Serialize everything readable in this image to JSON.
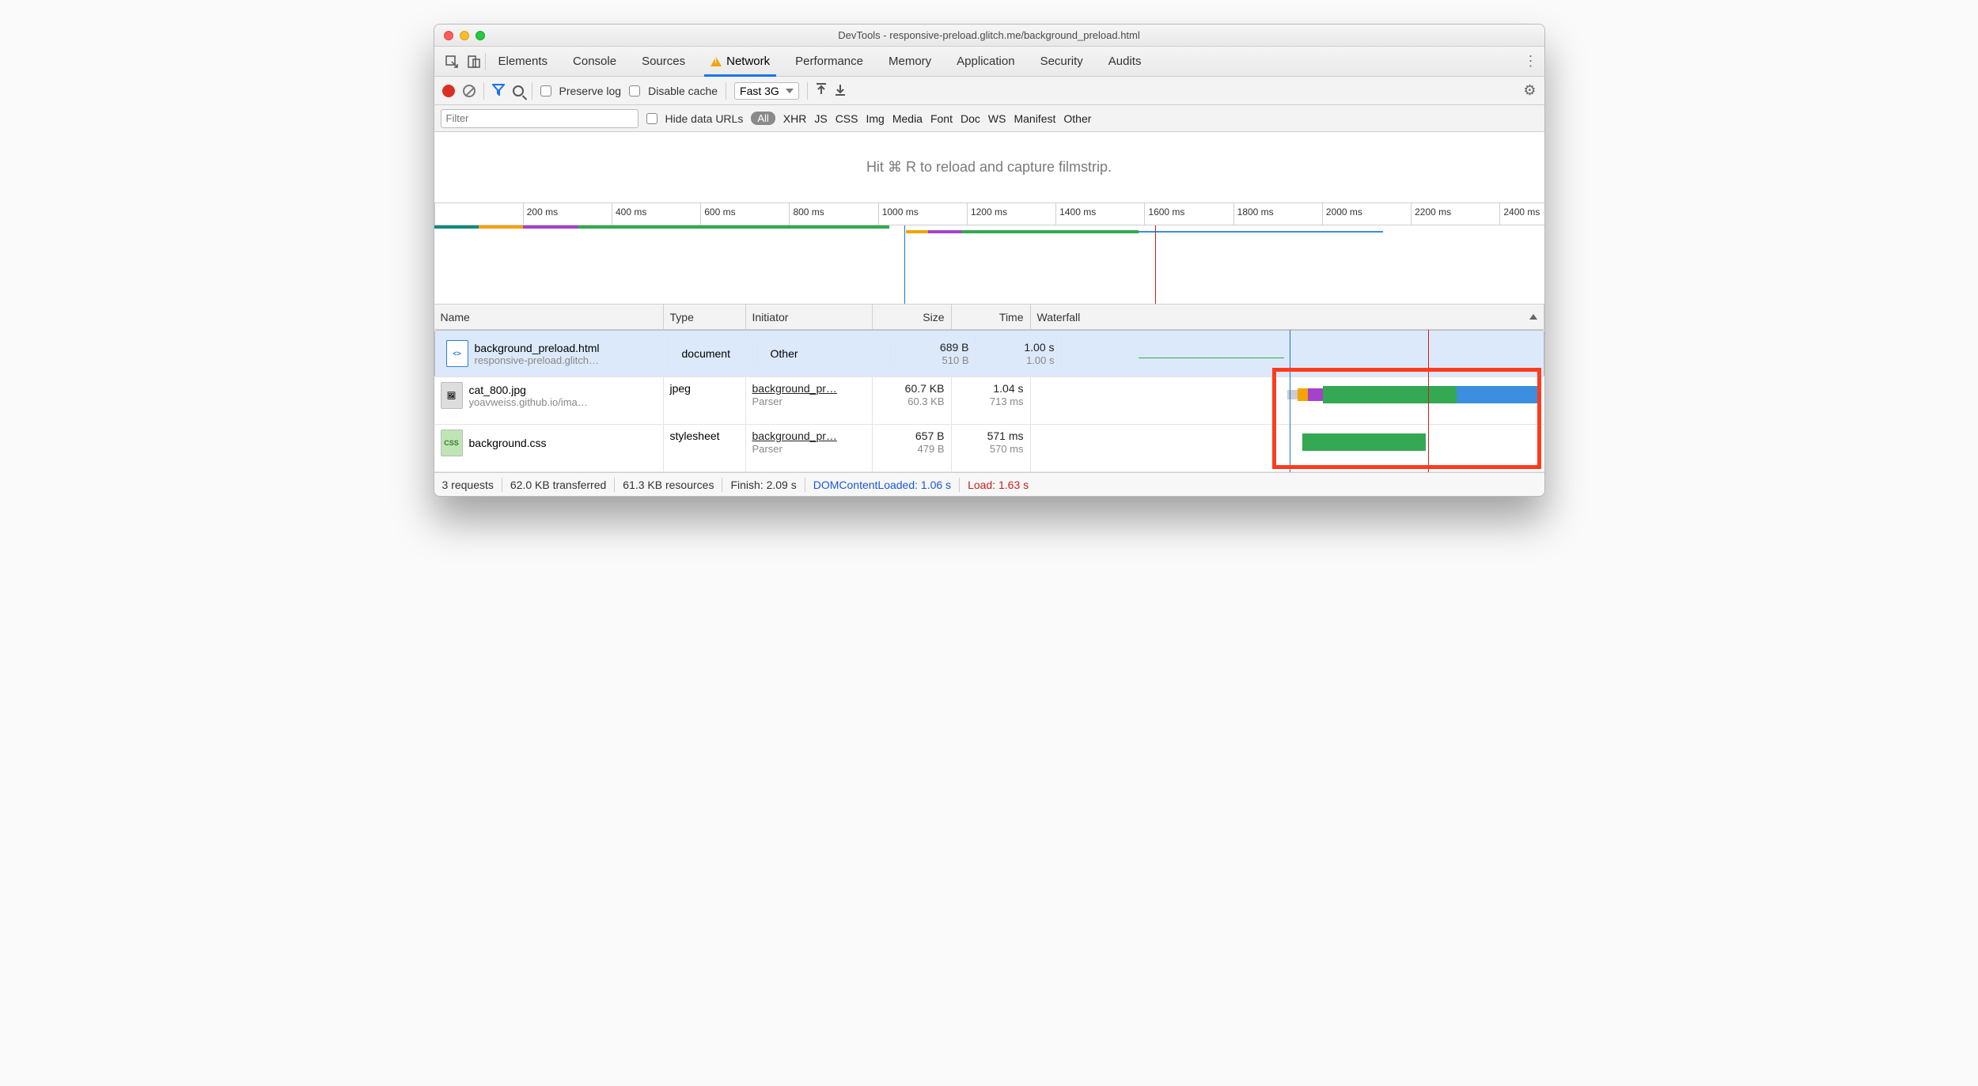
{
  "window": {
    "title": "DevTools - responsive-preload.glitch.me/background_preload.html"
  },
  "tabs": {
    "items": [
      "Elements",
      "Console",
      "Sources",
      "Network",
      "Performance",
      "Memory",
      "Application",
      "Security",
      "Audits"
    ],
    "active": "Network"
  },
  "toolbar": {
    "preserve_log": "Preserve log",
    "disable_cache": "Disable cache",
    "throttle": "Fast 3G"
  },
  "filterbar": {
    "placeholder": "Filter",
    "hide_data_urls": "Hide data URLs",
    "all_label": "All",
    "types": [
      "XHR",
      "JS",
      "CSS",
      "Img",
      "Media",
      "Font",
      "Doc",
      "WS",
      "Manifest",
      "Other"
    ]
  },
  "filmstrip": {
    "hint": "Hit ⌘ R to reload and capture filmstrip."
  },
  "ruler": {
    "labels": [
      "200 ms",
      "400 ms",
      "600 ms",
      "800 ms",
      "1000 ms",
      "1200 ms",
      "1400 ms",
      "1600 ms",
      "1800 ms",
      "2000 ms",
      "2200 ms",
      "2400 ms"
    ],
    "max_ms": 2500
  },
  "columns": {
    "name": "Name",
    "type": "Type",
    "initiator": "Initiator",
    "size": "Size",
    "time": "Time",
    "waterfall": "Waterfall"
  },
  "requests": [
    {
      "name": "background_preload.html",
      "sub": "responsive-preload.glitch…",
      "icon": "html",
      "type": "document",
      "initiator": "Other",
      "initiator_sub": "",
      "size": "689 B",
      "size_sub": "510 B",
      "time": "1.00 s",
      "time_sub": "1.00 s"
    },
    {
      "name": "cat_800.jpg",
      "sub": "yoavweiss.github.io/ima…",
      "icon": "img",
      "type": "jpeg",
      "initiator": "background_pr…",
      "initiator_sub": "Parser",
      "size": "60.7 KB",
      "size_sub": "60.3 KB",
      "time": "1.04 s",
      "time_sub": "713 ms"
    },
    {
      "name": "background.css",
      "sub": "",
      "icon": "css",
      "type": "stylesheet",
      "initiator": "background_pr…",
      "initiator_sub": "Parser",
      "size": "657 B",
      "size_sub": "479 B",
      "time": "571 ms",
      "time_sub": "570 ms"
    }
  ],
  "status": {
    "requests": "3 requests",
    "transferred": "62.0 KB transferred",
    "resources": "61.3 KB resources",
    "finish": "Finish: 2.09 s",
    "dcl": "DOMContentLoaded: 1.06 s",
    "load": "Load: 1.63 s"
  },
  "colors": {
    "green": "#34a853",
    "orange": "#f5a300",
    "teal": "#0b8a7f",
    "purple": "#a442c9",
    "blue": "#3b8fde",
    "dcl_line": "#1a73e8",
    "load_line": "#c5221f"
  }
}
